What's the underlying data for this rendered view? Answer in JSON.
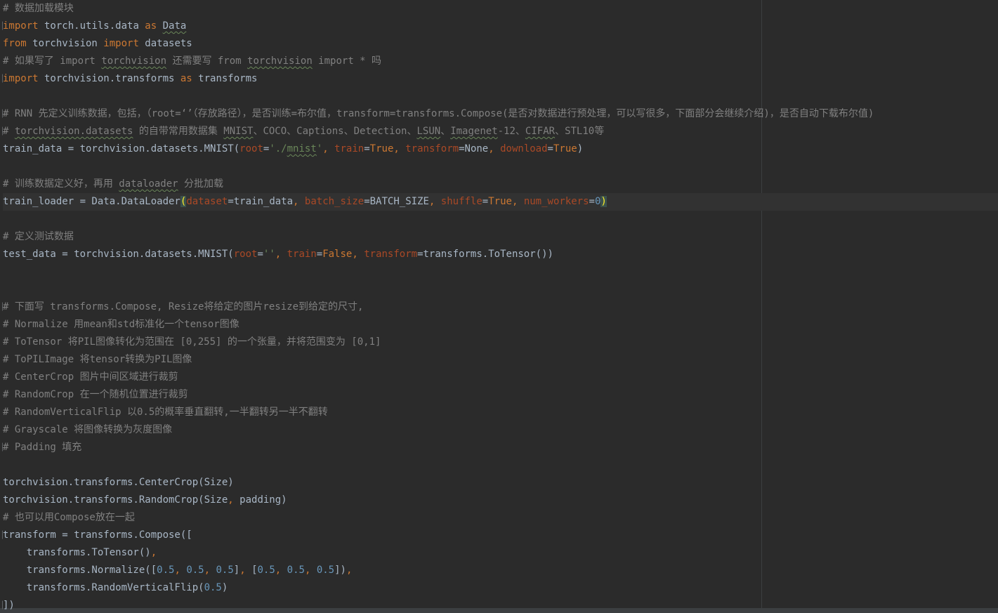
{
  "colors": {
    "background": "#2b2b2b",
    "comment": "#808080",
    "keyword": "#cc7832",
    "string": "#6a8759",
    "number": "#6897bb",
    "parameter": "#aa4926",
    "code": "#a9b7c6"
  },
  "code": {
    "l1": "# 数据加载模块",
    "l2": {
      "kw1": "import",
      "t1": " torch.utils.data ",
      "kw2": "as",
      "t2": " ",
      "t3": "Data"
    },
    "l3": {
      "kw1": "from",
      "t1": " torchvision ",
      "kw2": "import",
      "t2": " datasets"
    },
    "l4": {
      "c1": "# 如果写了 import ",
      "c2": "torchvision",
      "c3": " 还需要写 from ",
      "c4": "torchvision",
      "c5": " import * 吗"
    },
    "l5": {
      "kw1": "import",
      "t1": " torchvision.transforms ",
      "kw2": "as",
      "t2": " transforms"
    },
    "l6": "",
    "l7": "# RNN 先定义训练数据，包括，（root=‘’（存放路径），是否训练=布尔值，transform=transforms.Compose(是否对数据进行预处理，可以写很多，下面部分会继续介绍)，是否自动下载布尔值)",
    "l8": {
      "c1": "# ",
      "c2": "torchvision.datasets",
      "c3": " 的自带常用数据集 ",
      "c4": "MNIST",
      "c5": "、COCO、Captions、Detection、",
      "c6": "LSUN",
      "c7": "、",
      "c8": "Imagenet",
      "c9": "-12、",
      "c10": "CIFAR",
      "c11": "、STL10等"
    },
    "l9": {
      "t1": "train_data = torchvision.datasets.MNIST(",
      "p1": "root",
      "t2": "=",
      "s1": "'./",
      "s2": "mnist",
      "s3": "'",
      "k1": ", ",
      "p2": "train",
      "t3": "=",
      "k2": "True",
      "k3": ", ",
      "p3": "transform",
      "t4": "=None",
      "k4": ", ",
      "p4": "download",
      "t5": "=",
      "k5": "True",
      "t6": ")"
    },
    "l10": "",
    "l11": {
      "c1": "# 训练数据定义好，再用 ",
      "c2": "dataloader",
      "c3": " 分批加载"
    },
    "l12": {
      "t1": "train_loader = Data.DataLoader",
      "b1": "(",
      "p1": "dataset",
      "t2": "=train_data",
      "k1": ", ",
      "p2": "batch_size",
      "t3": "=BATCH_SIZE",
      "k2": ", ",
      "p3": "shuffle",
      "t4": "=",
      "k3": "True",
      "k4": ", ",
      "p4": "num_workers",
      "t5": "=",
      "n1": "0",
      "b2": ")"
    },
    "l13": "",
    "l14": "# 定义测试数据",
    "l15": {
      "t1": "test_data = torchvision.datasets.MNIST(",
      "p1": "root",
      "t2": "=",
      "s1": "''",
      "k1": ", ",
      "p2": "train",
      "t3": "=",
      "k2": "False",
      "k3": ", ",
      "p3": "transform",
      "t4": "=transforms.ToTensor())"
    },
    "l16": "",
    "l17": "",
    "l18": "# 下面写 transforms.Compose, Resize将给定的图片resize到给定的尺寸,",
    "l19": "# Normalize 用mean和std标准化一个tensor图像",
    "l20": "# ToTensor 将PIL图像转化为范围在 [0,255] 的一个张量，并将范围变为 [0,1]",
    "l21": "# ToPILImage 将tensor转换为PIL图像",
    "l22": "# CenterCrop 图片中间区域进行裁剪",
    "l23": "# RandomCrop 在一个随机位置进行裁剪",
    "l24": "# RandomVerticalFlip 以0.5的概率垂直翻转,一半翻转另一半不翻转",
    "l25": "# Grayscale 将图像转换为灰度图像",
    "l26": "# Padding 填充",
    "l27": "",
    "l28": "torchvision.transforms.CenterCrop(Size)",
    "l29": {
      "t1": "torchvision.transforms.RandomCrop(Size",
      "k1": ",",
      "t2": " padding)"
    },
    "l30": "# 也可以用Compose放在一起",
    "l31": "transform = transforms.Compose([",
    "l32": {
      "t1": "    transforms.ToTensor()",
      "k1": ","
    },
    "l33": {
      "t1": "    transforms.Normalize([",
      "n1": "0.5",
      "k1": ", ",
      "n2": "0.5",
      "k2": ", ",
      "n3": "0.5",
      "t2": "]",
      "k3": ", ",
      "t3": "[",
      "n4": "0.5",
      "k4": ", ",
      "n5": "0.5",
      "k5": ", ",
      "n6": "0.5",
      "t4": "])",
      "k6": ","
    },
    "l34": {
      "t1": "    transforms.RandomVerticalFlip(",
      "n1": "0.5",
      "t2": ")"
    },
    "l35": "])"
  }
}
